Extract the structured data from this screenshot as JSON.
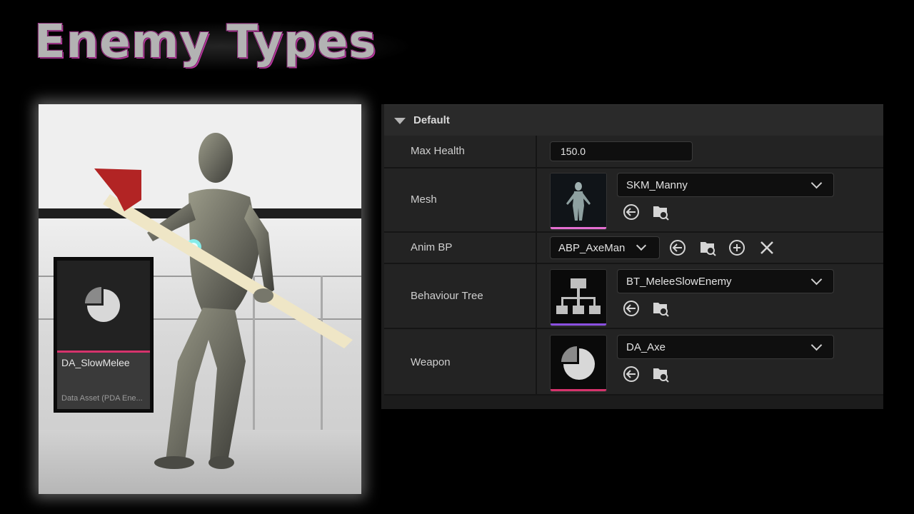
{
  "page": {
    "title": "Enemy Types"
  },
  "asset_card": {
    "name": "DA_SlowMelee",
    "type": "Data Asset (PDA Ene..."
  },
  "details": {
    "section": "Default",
    "accent_colors": {
      "mesh": "#e46fd1",
      "tree": "#8a4fe0",
      "weapon": "#d6336c"
    },
    "properties": {
      "max_health": {
        "label": "Max Health",
        "value": "150.0"
      },
      "mesh": {
        "label": "Mesh",
        "value": "SKM_Manny"
      },
      "anim_bp": {
        "label": "Anim BP",
        "value": "ABP_AxeMan"
      },
      "behaviour_tree": {
        "label": "Behaviour Tree",
        "value": "BT_MeleeSlowEnemy"
      },
      "weapon": {
        "label": "Weapon",
        "value": "DA_Axe"
      }
    }
  },
  "icons": [
    "use-selected-icon",
    "browse-icon",
    "add-icon",
    "clear-icon",
    "pie-chart-icon",
    "tree-icon",
    "chevron-down-icon",
    "collapse-caret-icon"
  ]
}
